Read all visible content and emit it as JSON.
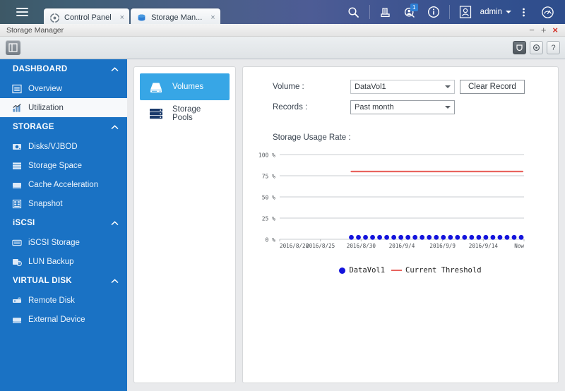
{
  "desktop": {
    "menu_icon": "hamburger-icon",
    "tabs": [
      {
        "label": "Control Panel",
        "icon": "gear-icon",
        "close": "×",
        "active": false
      },
      {
        "label": "Storage Man...",
        "icon": "storage-icon",
        "close": "×",
        "active": true
      }
    ],
    "tools": [
      {
        "name": "search-icon"
      },
      {
        "name": "notes-icon"
      },
      {
        "name": "notifications-icon",
        "badge": "1"
      },
      {
        "name": "info-icon"
      },
      {
        "name": "user-avatar-icon"
      }
    ],
    "user": "admin",
    "more_icon": "more-vertical-icon",
    "monitor_icon": "dashboard-gauge-icon"
  },
  "window": {
    "title": "Storage Manager",
    "minimize": "−",
    "maximize": "+",
    "close": "×",
    "toolbar": {
      "panel_toggle": "panel-toggle-icon",
      "right_buttons": [
        {
          "name": "wizard-icon",
          "label": ""
        },
        {
          "name": "settings-gear-icon",
          "label": "⚙"
        },
        {
          "name": "help-icon",
          "label": "?"
        }
      ]
    }
  },
  "sidebar": {
    "groups": [
      {
        "title": "DASHBOARD",
        "collapse_icon": "chevron-up-icon",
        "items": [
          {
            "label": "Overview",
            "icon": "overview-icon",
            "active": false
          },
          {
            "label": "Utilization",
            "icon": "utilization-chart-icon",
            "active": true
          }
        ]
      },
      {
        "title": "STORAGE",
        "collapse_icon": "chevron-up-icon",
        "items": [
          {
            "label": "Disks/VJBOD",
            "icon": "disk-icon",
            "active": false
          },
          {
            "label": "Storage Space",
            "icon": "storage-space-icon",
            "active": false
          },
          {
            "label": "Cache Acceleration",
            "icon": "cache-icon",
            "active": false
          },
          {
            "label": "Snapshot",
            "icon": "snapshot-icon",
            "active": false
          }
        ]
      },
      {
        "title": "iSCSI",
        "collapse_icon": "chevron-up-icon",
        "items": [
          {
            "label": "iSCSI Storage",
            "icon": "iscsi-storage-icon",
            "active": false
          },
          {
            "label": "LUN Backup",
            "icon": "lun-backup-icon",
            "active": false
          }
        ]
      },
      {
        "title": "VIRTUAL DISK",
        "collapse_icon": "chevron-up-icon",
        "items": [
          {
            "label": "Remote Disk",
            "icon": "remote-disk-icon",
            "active": false
          },
          {
            "label": "External Device",
            "icon": "external-device-icon",
            "active": false
          }
        ]
      }
    ]
  },
  "volume_list": [
    {
      "label": "Volumes",
      "icon": "volume-icon",
      "selected": true
    },
    {
      "label": "Storage Pools",
      "icon": "storage-pool-icon",
      "selected": false
    }
  ],
  "form": {
    "volume_label": "Volume :",
    "volume_value": "DataVol1",
    "clear_record_label": "Clear Record",
    "records_label": "Records :",
    "records_value": "Past month"
  },
  "chart_title": "Storage Usage Rate :",
  "chart_data": {
    "type": "scatter",
    "title": "Storage Usage Rate :",
    "xlabel": "",
    "ylabel": "%",
    "ylim": [
      0,
      100
    ],
    "yticks": [
      "100 %",
      "75 %",
      "50 %",
      "25 %",
      "0 %"
    ],
    "ytick_values": [
      100,
      75,
      50,
      25,
      0
    ],
    "xticks": [
      "2016/8/20",
      "2016/8/25",
      "2016/8/30",
      "2016/9/4",
      "2016/9/9",
      "2016/9/14",
      "Now"
    ],
    "grid": true,
    "legend_position": "bottom",
    "series": [
      {
        "name": "DataVol1",
        "type": "scatter",
        "color": "#1414dc",
        "x": [
          "2016/8/26",
          "2016/8/27",
          "2016/8/28",
          "2016/8/29",
          "2016/8/30",
          "2016/8/31",
          "2016/9/1",
          "2016/9/2",
          "2016/9/3",
          "2016/9/4",
          "2016/9/5",
          "2016/9/6",
          "2016/9/7",
          "2016/9/8",
          "2016/9/9",
          "2016/9/10",
          "2016/9/11",
          "2016/9/12",
          "2016/9/13",
          "2016/9/14",
          "2016/9/15",
          "2016/9/16",
          "2016/9/17",
          "2016/9/18",
          "Now"
        ],
        "values": [
          1,
          1,
          1,
          1,
          1,
          1,
          1,
          1,
          1,
          1,
          1,
          1,
          1,
          1,
          1,
          1,
          1,
          1,
          1,
          1,
          1,
          1,
          1,
          1,
          1
        ]
      },
      {
        "name": "Current Threshold",
        "type": "line",
        "color": "#e8645e",
        "values": [
          80,
          80
        ],
        "constant": 80
      }
    ]
  },
  "legend": [
    {
      "label": "DataVol1",
      "marker": "dot",
      "color": "#1414dc"
    },
    {
      "label": "Current Threshold",
      "marker": "line",
      "color": "#e8645e"
    }
  ],
  "colors": {
    "sidebar_bg": "#1a72c4",
    "selected_blue": "#37a6e6",
    "threshold_red": "#e8645e",
    "point_blue": "#1414dc"
  }
}
